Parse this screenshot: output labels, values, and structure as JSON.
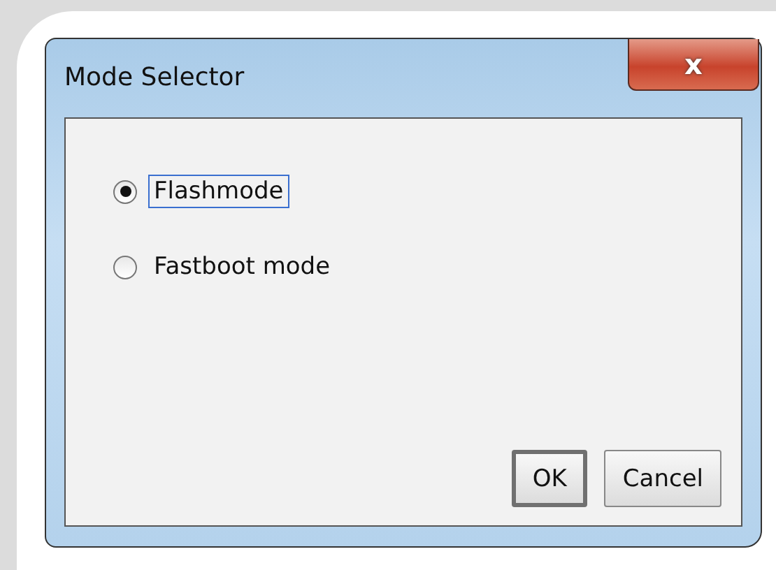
{
  "window": {
    "title": "Mode Selector",
    "close_label": "x"
  },
  "options": [
    {
      "label": "Flashmode",
      "selected": true
    },
    {
      "label": "Fastboot mode",
      "selected": false
    }
  ],
  "buttons": [
    {
      "label": "OK",
      "default": true
    },
    {
      "label": "Cancel",
      "default": false
    }
  ]
}
